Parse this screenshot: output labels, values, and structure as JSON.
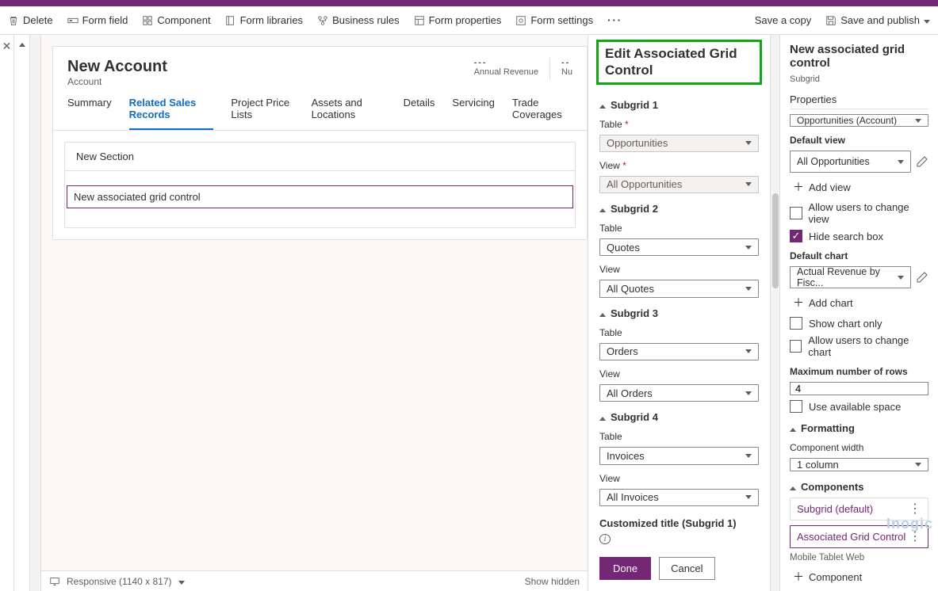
{
  "toolbar": {
    "delete": "Delete",
    "formField": "Form field",
    "component": "Component",
    "formLibraries": "Form libraries",
    "businessRules": "Business rules",
    "formProperties": "Form properties",
    "formSettings": "Form settings",
    "saveCopy": "Save a copy",
    "saveAndPublish": "Save and publish"
  },
  "page": {
    "title": "New Account",
    "entity": "Account",
    "kpi1": "Annual Revenue",
    "kpi2": "Nu"
  },
  "tabs": [
    "Summary",
    "Related Sales Records",
    "Project Price Lists",
    "Assets and Locations",
    "Details",
    "Servicing",
    "Trade Coverages"
  ],
  "activeTab": 1,
  "section": {
    "title": "New Section",
    "field": "New associated grid control"
  },
  "editPanel": {
    "title": "Edit Associated Grid Control",
    "subgrids": [
      {
        "name": "Subgrid 1",
        "tableLabel": "Table",
        "tableReq": true,
        "table": "Opportunities",
        "tableDisabled": true,
        "viewLabel": "View",
        "viewReq": true,
        "view": "All Opportunities",
        "viewDisabled": true
      },
      {
        "name": "Subgrid 2",
        "tableLabel": "Table",
        "tableReq": false,
        "table": "Quotes",
        "tableDisabled": false,
        "viewLabel": "View",
        "viewReq": false,
        "view": "All Quotes",
        "viewDisabled": false
      },
      {
        "name": "Subgrid 3",
        "tableLabel": "Table",
        "tableReq": false,
        "table": "Orders",
        "tableDisabled": false,
        "viewLabel": "View",
        "viewReq": false,
        "view": "All Orders",
        "viewDisabled": false
      },
      {
        "name": "Subgrid 4",
        "tableLabel": "Table",
        "tableReq": false,
        "table": "Invoices",
        "tableDisabled": false,
        "viewLabel": "View",
        "viewReq": false,
        "view": "All Invoices",
        "viewDisabled": false
      }
    ],
    "customTitleLabel": "Customized title (Subgrid 1)",
    "done": "Done",
    "cancel": "Cancel"
  },
  "props": {
    "title": "New associated grid control",
    "subtitle": "Subgrid",
    "propertiesLabel": "Properties",
    "tableDD": "Opportunities (Account)",
    "defaultViewLabel": "Default view",
    "defaultView": "All Opportunities",
    "addView": "Add view",
    "allowChangeView": "Allow users to change view",
    "hideSearch": "Hide search box",
    "defaultChartLabel": "Default chart",
    "defaultChart": "Actual Revenue by Fisc...",
    "addChart": "Add chart",
    "showChartOnly": "Show chart only",
    "allowChangeChart": "Allow users to change chart",
    "maxRowsLabel": "Maximum number of rows",
    "maxRows": "4",
    "useAvailSpace": "Use available space",
    "formatting": "Formatting",
    "compWidthLabel": "Component width",
    "compWidth": "1 column",
    "componentsLabel": "Components",
    "comp1": "Subgrid (default)",
    "comp2": "Associated Grid Control",
    "platforms": "Mobile Tablet Web",
    "addComponent": "Component"
  },
  "bottom": {
    "mode": "Responsive (1140 x 817)",
    "showHidden": "Show hidden"
  },
  "watermark": "Inogic"
}
